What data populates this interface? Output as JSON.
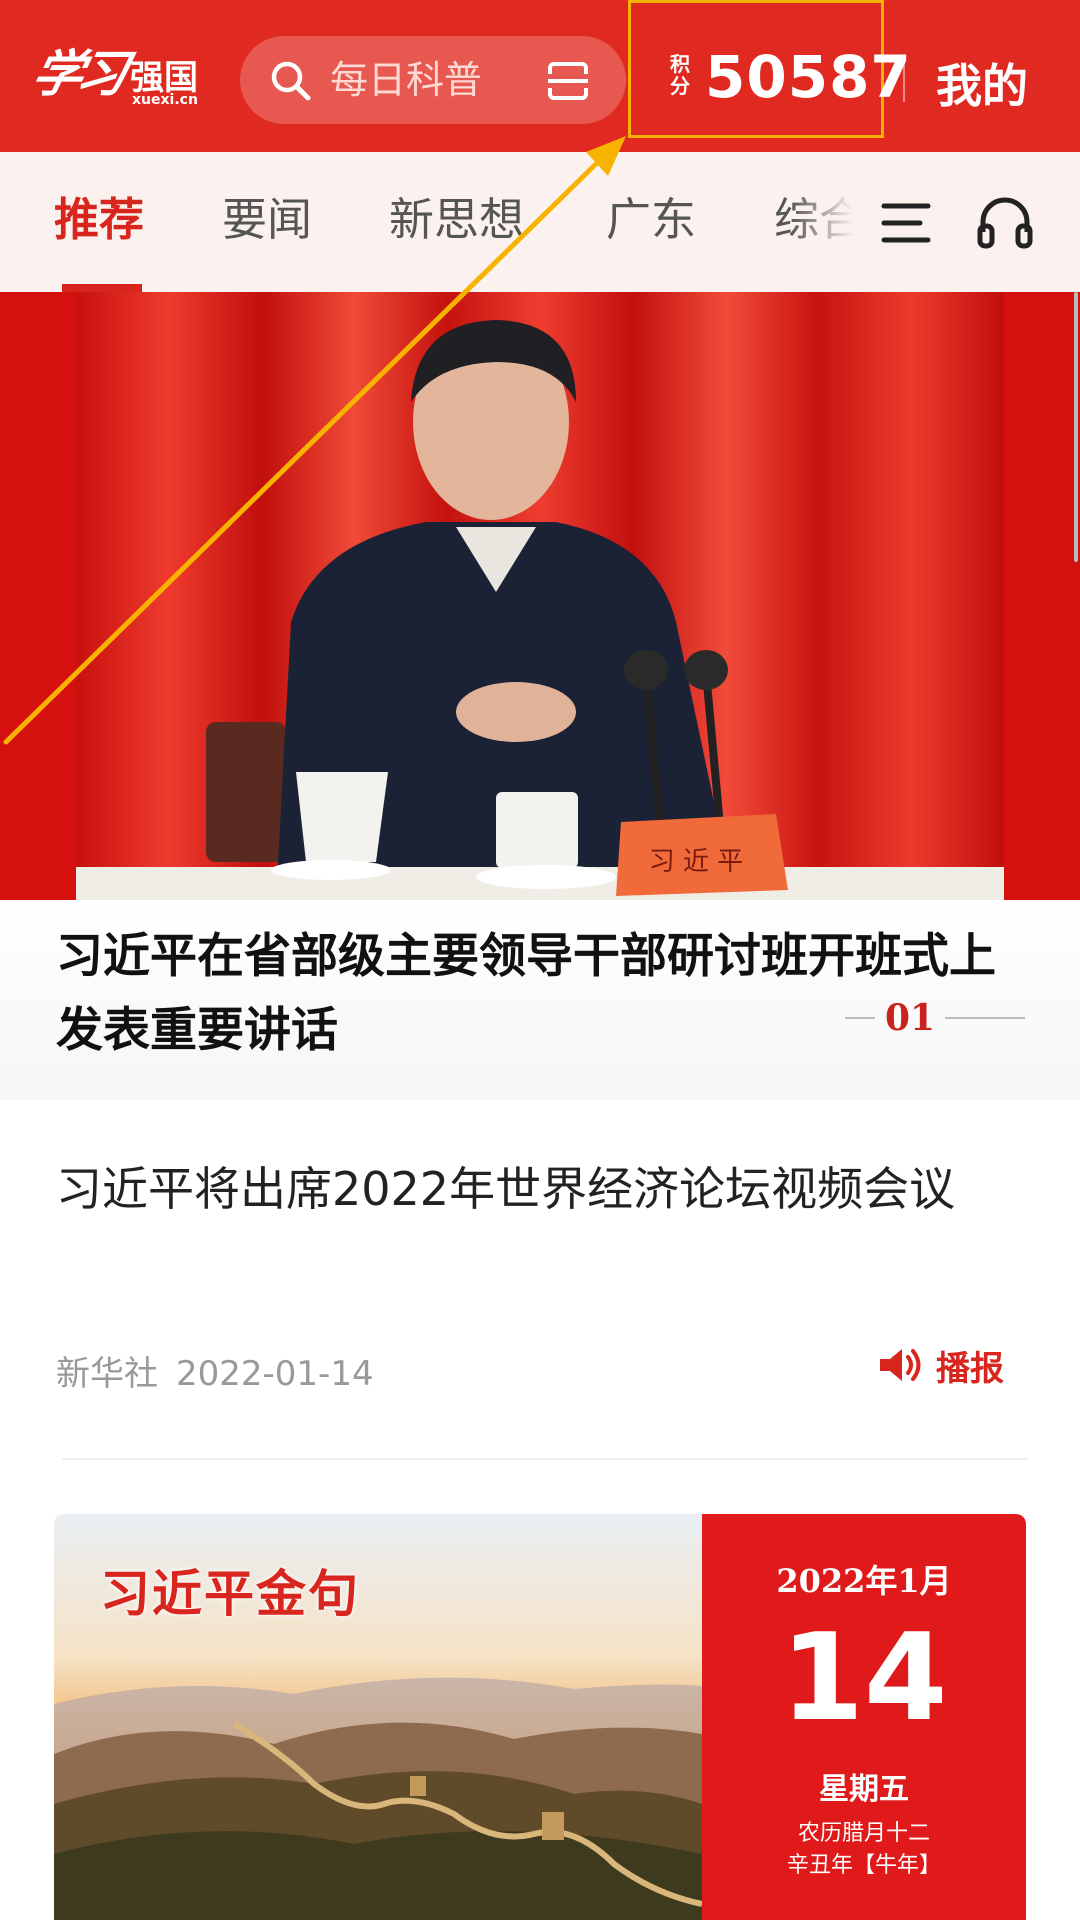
{
  "header": {
    "logo_script": "学习",
    "logo_main": "强国",
    "logo_sub": "xuexi.cn",
    "search_placeholder": "每日科普",
    "points_label_1": "积",
    "points_label_2": "分",
    "points_value": "50587",
    "mine_label": "我的"
  },
  "tabs": [
    {
      "label": "推荐",
      "active": true
    },
    {
      "label": "要闻",
      "active": false
    },
    {
      "label": "新思想",
      "active": false
    },
    {
      "label": "广东",
      "active": false
    },
    {
      "label": "综合",
      "active": false
    }
  ],
  "hero": {
    "nameplate": "习 近 平"
  },
  "headline": {
    "title": "习近平在省部级主要领导干部研讨班开班式上发表重要讲话",
    "index": "01"
  },
  "article": {
    "title": "习近平将出席2022年世界经济论坛视频会议",
    "source": "新华社",
    "date": "2022-01-14",
    "broadcast_label": "播报"
  },
  "quote_card": {
    "title": "习近平金句",
    "year_month": "2022年1月",
    "day": "14",
    "weekday": "星期五",
    "lunar_line1": "农历腊月十二",
    "lunar_line2": "辛丑年【牛年】"
  },
  "colors": {
    "brand_red": "#e02a21",
    "annotation": "#f7b300"
  }
}
